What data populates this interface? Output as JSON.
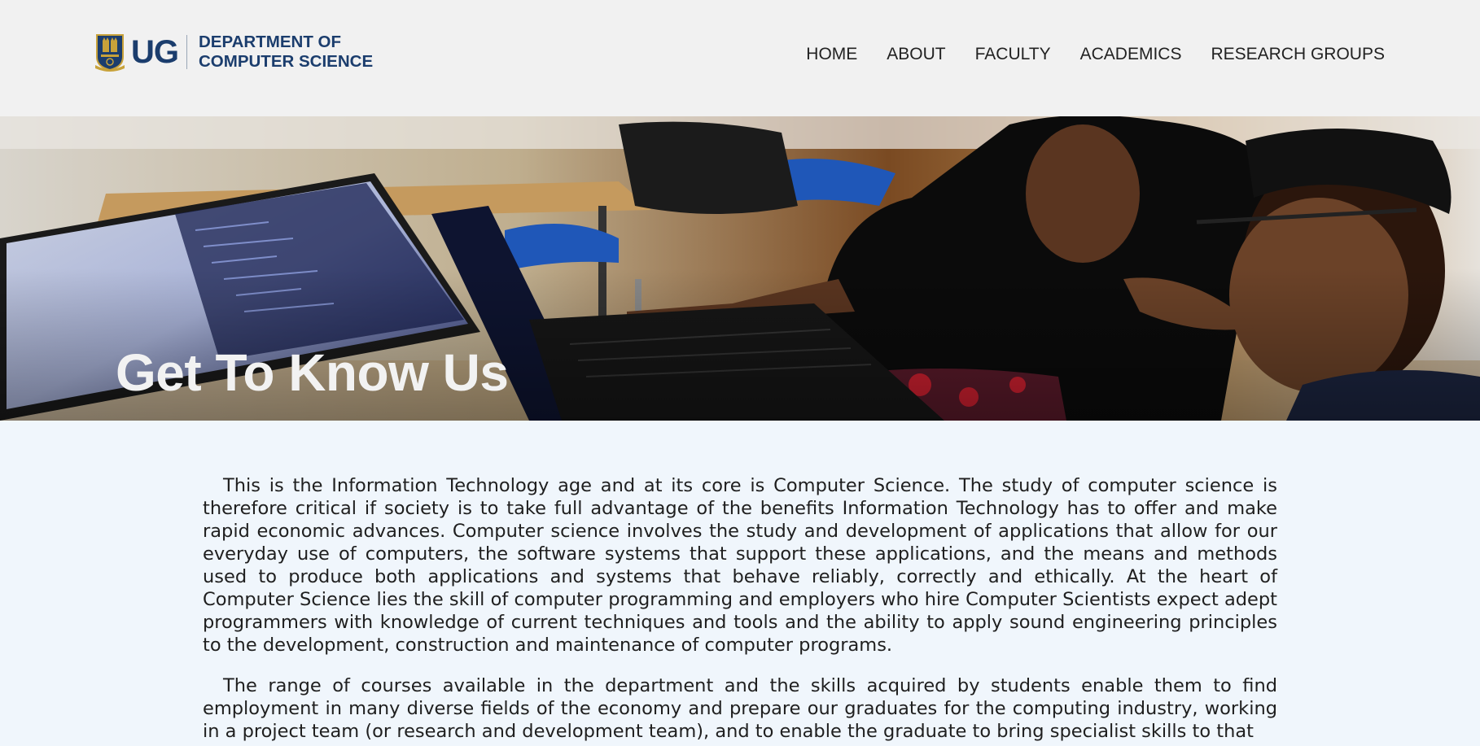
{
  "header": {
    "logo_text": "UG",
    "department_line1": "DEPARTMENT OF",
    "department_line2": "COMPUTER SCIENCE"
  },
  "nav": {
    "items": [
      {
        "label": "HOME"
      },
      {
        "label": "ABOUT"
      },
      {
        "label": "FACULTY"
      },
      {
        "label": "ACADEMICS"
      },
      {
        "label": "RESEARCH GROUPS"
      }
    ]
  },
  "hero": {
    "title": "Get To Know Us"
  },
  "content": {
    "paragraphs": [
      "This is the Information Technology age and at its core is Computer Science. The study of computer science is therefore critical if society is to take full advantage of the benefits Information Technology has to offer and make rapid economic advances. Computer science involves the study and development of applications that allow for our everyday use of computers, the software systems that support these applications, and the means and methods used to produce both applications and systems that behave reliably, correctly and ethically. At the heart of Computer Science lies the skill of computer programming and employers who hire Computer Scientists expect adept programmers with knowledge of current techniques and tools and the ability to apply sound engineering principles to the development, construction and maintenance of computer programs.",
      "The range of courses available in the department and the skills acquired by students enable them to find employment in many diverse fields of the economy and prepare our graduates for the computing industry, working in a project team (or research and development team), and to enable the graduate to bring specialist skills to that"
    ]
  },
  "colors": {
    "brand_navy": "#1b3d6d",
    "header_bg": "#f1f1f1",
    "page_bg": "#f0f6fc"
  }
}
